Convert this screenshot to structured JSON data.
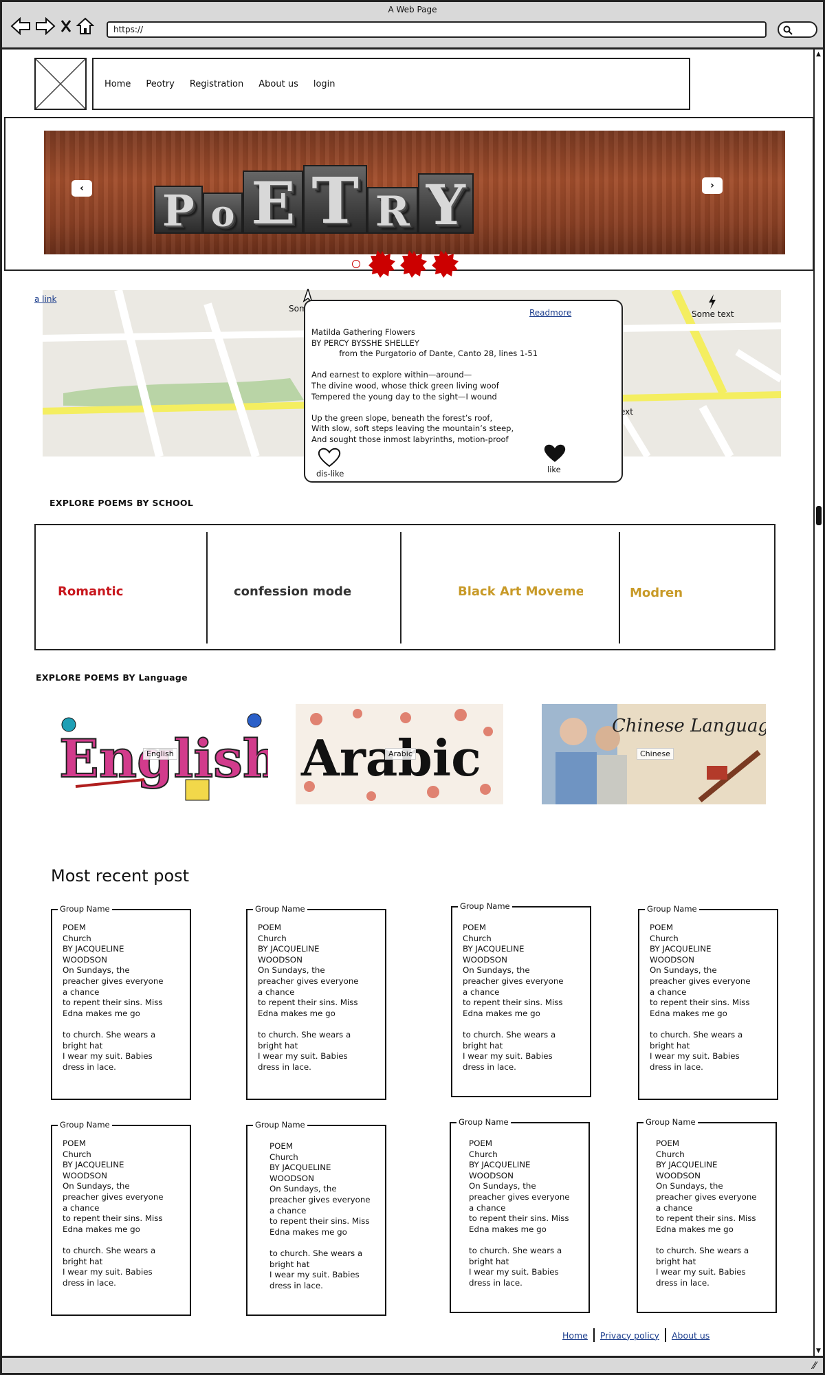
{
  "window": {
    "title": "A Web Page",
    "url": "https://"
  },
  "nav": {
    "items": [
      "Home",
      "Peotry",
      "Registration",
      "About us",
      "login"
    ]
  },
  "carousel": {
    "image_text": "POETRY",
    "prev_icon": "chevron-left-icon",
    "next_icon": "chevron-right-icon",
    "slide_count": 4,
    "active_slide": 0
  },
  "map": {
    "link": "a link",
    "labels": [
      "Som",
      "Some text",
      "ext"
    ]
  },
  "popup": {
    "readmore": "Readmore",
    "poem": "Matilda Gathering Flowers\nBY PERCY BYSSHE SHELLEY\n           from the Purgatorio of Dante, Canto 28, lines 1-51\n\nAnd earnest to explore within—around—\nThe divine wood, whose thick green living woof\nTempered the young day to the sight—I wound\n\nUp the green slope, beneath the forest’s roof,\nWith slow, soft steps leaving the mountain’s steep,\nAnd sought those inmost labyrinths, motion-proof",
    "dislike": "dis-like",
    "like": "like"
  },
  "school": {
    "heading": "EXPLORE POEMS BY SCHOOL",
    "items": [
      {
        "label": "Romantic",
        "color": "#c8181e"
      },
      {
        "label": "confession mode",
        "color": "#333333"
      },
      {
        "label": "Black Art Movemen",
        "color": "#c89a28"
      },
      {
        "label": "Modren",
        "color": "#c89a28"
      }
    ]
  },
  "language": {
    "heading": "EXPLORE POEMS BY Language",
    "items": [
      {
        "label": "English",
        "image_text": "English!"
      },
      {
        "label": "Arabic",
        "image_text": "Arabic"
      },
      {
        "label": "Chinese",
        "image_text": "Chinese Language"
      }
    ]
  },
  "recent": {
    "heading": "Most recent post",
    "cards": [
      {
        "title": "Group Name",
        "body": "POEM\nChurch\nBY JACQUELINE\nWOODSON\nOn Sundays, the\npreacher gives everyone\na chance\nto repent their sins. Miss\nEdna makes me go\n\nto church. She wears a\nbright hat\nI wear my suit. Babies\ndress in lace."
      },
      {
        "title": "Group Name",
        "body": "POEM\nChurch\nBY JACQUELINE\nWOODSON\nOn Sundays, the\npreacher gives everyone\na chance\nto repent their sins. Miss\nEdna makes me go\n\nto church. She wears a\nbright hat\nI wear my suit. Babies\ndress in lace."
      },
      {
        "title": "Group Name",
        "body": "POEM\nChurch\nBY JACQUELINE\nWOODSON\nOn Sundays, the\npreacher gives everyone\na chance\nto repent their sins. Miss\nEdna makes me go\n\nto church. She wears a\nbright hat\nI wear my suit. Babies\ndress in lace."
      },
      {
        "title": "Group Name",
        "body": "POEM\nChurch\nBY JACQUELINE\nWOODSON\nOn Sundays, the\npreacher gives everyone\na chance\nto repent their sins. Miss\nEdna makes me go\n\nto church. She wears a\nbright hat\nI wear my suit. Babies\ndress in lace."
      },
      {
        "title": "Group Name",
        "body": "POEM\nChurch\nBY JACQUELINE\nWOODSON\nOn Sundays, the\npreacher gives everyone\na chance\nto repent their sins. Miss\nEdna makes me go\n\nto church. She wears a\nbright hat\nI wear my suit. Babies\ndress in lace."
      },
      {
        "title": "Group Name",
        "body": "POEM\nChurch\nBY JACQUELINE\nWOODSON\nOn Sundays, the\npreacher gives everyone\na chance\nto repent their sins. Miss\nEdna makes me go\n\nto church. She wears a\nbright hat\nI wear my suit. Babies\ndress in lace."
      },
      {
        "title": "Group Name",
        "body": "POEM\nChurch\nBY JACQUELINE\nWOODSON\nOn Sundays, the\npreacher gives everyone\na chance\nto repent their sins. Miss\nEdna makes me go\n\nto church. She wears a\nbright hat\nI wear my suit. Babies\ndress in lace."
      },
      {
        "title": "Group Name",
        "body": "POEM\nChurch\nBY JACQUELINE\nWOODSON\nOn Sundays, the\npreacher gives everyone\na chance\nto repent their sins. Miss\nEdna makes me go\n\nto church. She wears a\nbright hat\nI wear my suit. Babies\ndress in lace."
      }
    ]
  },
  "footer": {
    "links": [
      "Home",
      "Privacy policy",
      "About us"
    ]
  },
  "colors": {
    "link": "#1a3c8c",
    "accent_red": "#cc0000",
    "chrome_gray": "#d9d9d9"
  }
}
